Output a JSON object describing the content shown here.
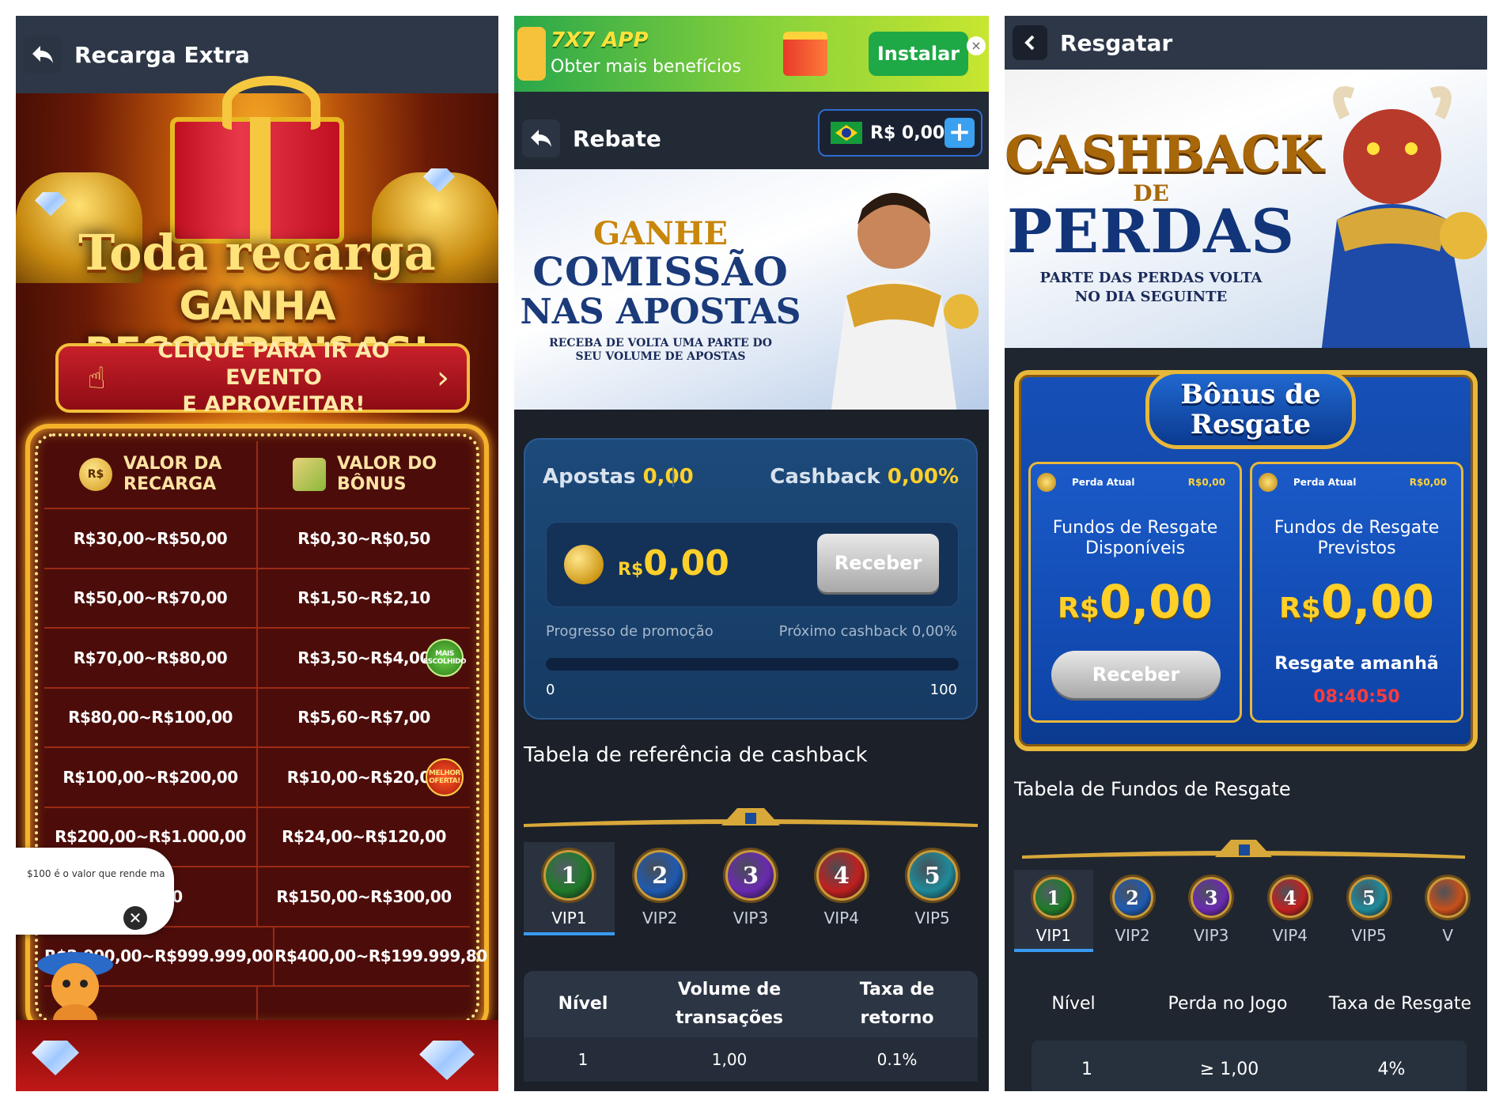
{
  "panel1": {
    "title": "Recarga Extra",
    "banner_line1": "Toda recarga",
    "banner_line2": "GANHA RECOMPENSAS!",
    "cta_line1": "CLIQUE PARA IR AO EVENTO",
    "cta_line2": "E APROVEITAR!",
    "col1_line1": "VALOR DA",
    "col1_line2": "RECARGA",
    "col1_icon_text": "R$",
    "col2_line1": "VALOR DO",
    "col2_line2": "BÔNUS",
    "rows": [
      {
        "recarga": "R$30,00~R$50,00",
        "bonus": "R$0,30~R$0,50"
      },
      {
        "recarga": "R$50,00~R$70,00",
        "bonus": "R$1,50~R$2,10"
      },
      {
        "recarga": "R$70,00~R$80,00",
        "bonus": "R$3,50~R$4,00"
      },
      {
        "recarga": "R$80,00~R$100,00",
        "bonus": "R$5,60~R$7,00"
      },
      {
        "recarga": "R$100,00~R$200,00",
        "bonus": "R$10,00~R$20,00"
      },
      {
        "recarga": "R$200,00~R$1.000,00",
        "bonus": "R$24,00~R$120,00"
      },
      {
        "recarga": ".000,00",
        "bonus": "R$150,00~R$300,00"
      },
      {
        "recarga": "R$2.000,00~R$999.999,00",
        "bonus": "R$400,00~R$199.999,80"
      }
    ],
    "badge_mais": "MAIS ESCOLHIDO",
    "badge_melhor": "MELHOR OFERTA!",
    "tooltip_text": "$100 é o valor que rende ma",
    "tooltip_close": "✕"
  },
  "panel2": {
    "ad_title": "7X7 APP",
    "ad_subtitle": "Obter mais benefícios",
    "ad_install": "Instalar",
    "ad_close": "×",
    "title": "Rebate",
    "balance": "R$ 0,00",
    "balance_plus": "+",
    "banner_line1": "GANHE",
    "banner_line2": "COMISSÃO",
    "banner_line3": "NAS APOSTAS",
    "banner_line4": "RECEBA DE VOLTA UMA PARTE DO SEU VOLUME DE APOSTAS",
    "apostas_label": "Apostas",
    "apostas_value": "0,00",
    "cashback_label": "Cashback",
    "cashback_value": "0,00%",
    "currency_small": "R$",
    "amount": "0,00",
    "receive": "Receber",
    "progress_label": "Progresso de promoção",
    "next_label": "Próximo cashback 0,00%",
    "progress_fraction": 0,
    "progress_min": "0",
    "progress_max": "100",
    "table_title": "Tabela de referência de cashback",
    "vip_tabs": [
      {
        "num": "1",
        "label": "VIP1",
        "color": "#1f7a2a"
      },
      {
        "num": "2",
        "label": "VIP2",
        "color": "#1f5ab0"
      },
      {
        "num": "3",
        "label": "VIP3",
        "color": "#6a2ab0"
      },
      {
        "num": "4",
        "label": "VIP4",
        "color": "#c02020"
      },
      {
        "num": "5",
        "label": "VIP5",
        "color": "#1f8a9a"
      }
    ],
    "th_nivel": "Nível",
    "th_volume": "Volume de transações",
    "th_taxa": "Taxa de retorno",
    "row_nivel": "1",
    "row_volume": "1,00",
    "row_taxa": "0.1%"
  },
  "panel3": {
    "title": "Resgatar",
    "banner_line1": "CASHBACK",
    "banner_line2": "DE",
    "banner_line3": "PERDAS",
    "banner_line4": "PARTE DAS PERDAS VOLTA NO DIA SEGUINTE",
    "plaque_line1": "Bônus de",
    "plaque_line2": "Resgate",
    "box1_hdr": "Perda Atual",
    "box1_hdr_amt": "R$0,00",
    "box1_title": "Fundos de Resgate Disponíveis",
    "box1_currency": "R$",
    "box1_value": "0,00",
    "box1_button": "Receber",
    "box2_hdr": "Perda Atual",
    "box2_hdr_amt": "R$0,00",
    "box2_title": "Fundos de Resgate Previstos",
    "box2_currency": "R$",
    "box2_value": "0,00",
    "box2_note": "Resgate amanhã",
    "box2_timer": "08:40:50",
    "table_title": "Tabela de Fundos de Resgate",
    "vip_tabs": [
      {
        "num": "1",
        "label": "VIP1",
        "color": "#1f7a2a"
      },
      {
        "num": "2",
        "label": "VIP2",
        "color": "#1f5ab0"
      },
      {
        "num": "3",
        "label": "VIP3",
        "color": "#6a2ab0"
      },
      {
        "num": "4",
        "label": "VIP4",
        "color": "#c02020"
      },
      {
        "num": "5",
        "label": "VIP5",
        "color": "#1f8a9a"
      },
      {
        "num": "",
        "label": "V",
        "color": "#c8501a"
      }
    ],
    "th_nivel": "Nível",
    "th_perda": "Perda no Jogo",
    "th_taxa": "Taxa de Resgate",
    "row_nivel": "1",
    "row_perda": "≥ 1,00",
    "row_taxa": "4%"
  },
  "colors": {
    "gold": "#ffd02a",
    "accent_blue": "#3a9aef",
    "timer_red": "#ff3a3a"
  }
}
